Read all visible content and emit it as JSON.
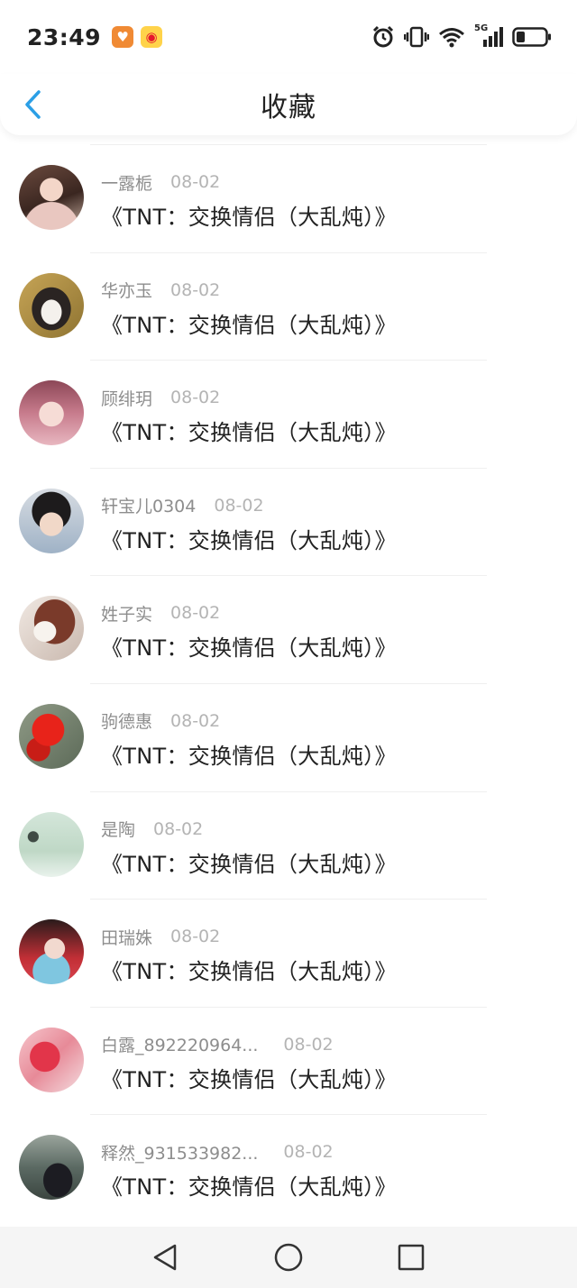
{
  "status_bar": {
    "time": "23:49",
    "network_label": "5G"
  },
  "header": {
    "title": "收藏"
  },
  "colors": {
    "accent": "#2b9fe6",
    "username": "#8d8d8d",
    "date": "#b4b4b4",
    "title_text": "#222222"
  },
  "favorites": [
    {
      "username": "一露栀",
      "date": "08-02",
      "title": "《TNT：交换情侣（大乱炖）》"
    },
    {
      "username": "华亦玉",
      "date": "08-02",
      "title": "《TNT：交换情侣（大乱炖）》"
    },
    {
      "username": "顾绯玥",
      "date": "08-02",
      "title": "《TNT：交换情侣（大乱炖）》"
    },
    {
      "username": "轩宝儿0304",
      "date": "08-02",
      "title": "《TNT：交换情侣（大乱炖）》"
    },
    {
      "username": "姓子实",
      "date": "08-02",
      "title": "《TNT：交换情侣（大乱炖）》"
    },
    {
      "username": "驹德惠",
      "date": "08-02",
      "title": "《TNT：交换情侣（大乱炖）》"
    },
    {
      "username": "是陶",
      "date": "08-02",
      "title": "《TNT：交换情侣（大乱炖）》"
    },
    {
      "username": "田瑞姝",
      "date": "08-02",
      "title": "《TNT：交换情侣（大乱炖）》"
    },
    {
      "username": "白露_892220964...",
      "date": "08-02",
      "title": "《TNT：交换情侣（大乱炖）》"
    },
    {
      "username": "释然_931533982...",
      "date": "08-02",
      "title": "《TNT：交换情侣（大乱炖）》"
    }
  ],
  "nav_bar": {
    "icons": [
      "back-triangle-icon",
      "home-circle-icon",
      "recents-square-icon"
    ]
  }
}
